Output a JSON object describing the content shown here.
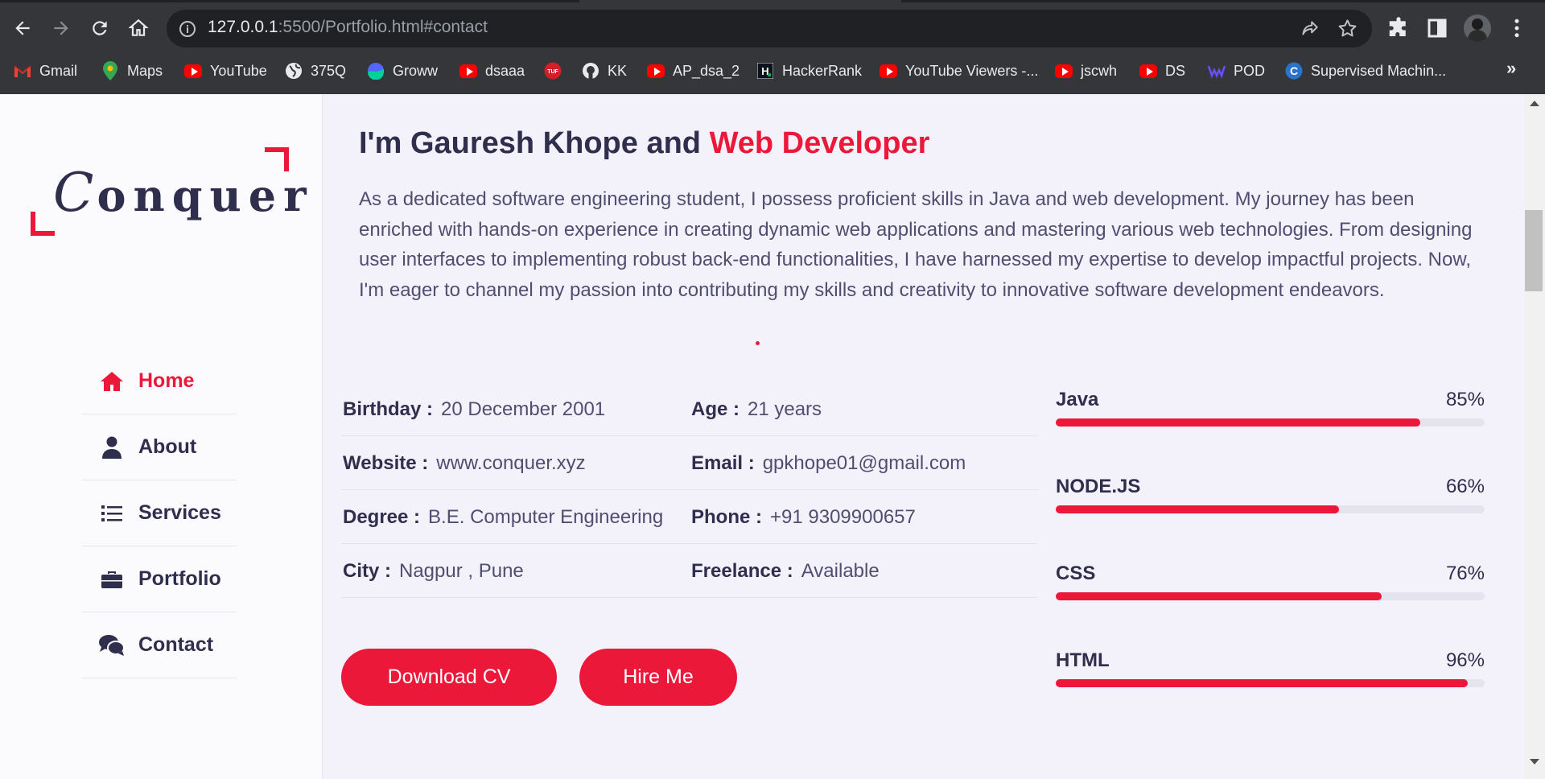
{
  "browser": {
    "url_host": "127.0.0.1",
    "url_rest": ":5500/Portfolio.html#contact",
    "bookmarks": [
      {
        "label": "Gmail",
        "icon": "gmail-icon"
      },
      {
        "label": "Maps",
        "icon": "maps-icon"
      },
      {
        "label": "YouTube",
        "icon": "youtube-icon"
      },
      {
        "label": "375Q",
        "icon": "globe-icon"
      },
      {
        "label": "Groww",
        "icon": "groww-icon"
      },
      {
        "label": "dsaaa",
        "icon": "youtube-icon"
      },
      {
        "label": "",
        "icon": "tuf-icon",
        "badge": "TUF"
      },
      {
        "label": "KK",
        "icon": "github-icon"
      },
      {
        "label": "AP_dsa_2",
        "icon": "youtube-icon"
      },
      {
        "label": "HackerRank",
        "icon": "hackerrank-icon",
        "badge": "H"
      },
      {
        "label": "YouTube Viewers -...",
        "icon": "youtube-icon"
      },
      {
        "label": "jscwh",
        "icon": "youtube-icon"
      },
      {
        "label": "DS",
        "icon": "youtube-icon"
      },
      {
        "label": "POD",
        "icon": "pod-icon"
      },
      {
        "label": "Supervised Machin...",
        "icon": "coursera-icon",
        "badge": "C"
      }
    ],
    "more": "»"
  },
  "sidebar": {
    "logo_initial": "C",
    "logo_rest": "onquer",
    "nav": [
      {
        "label": "Home",
        "icon": "home-icon",
        "active": true
      },
      {
        "label": "About",
        "icon": "user-icon",
        "active": false
      },
      {
        "label": "Services",
        "icon": "list-icon",
        "active": false
      },
      {
        "label": "Portfolio",
        "icon": "briefcase-icon",
        "active": false
      },
      {
        "label": "Contact",
        "icon": "comments-icon",
        "active": false
      }
    ]
  },
  "about": {
    "headline_prefix": "I'm Gauresh Khope and ",
    "headline_accent": "Web Developer",
    "intro": "As a dedicated software engineering student, I possess proficient skills in Java and web development. My journey has been enriched with hands-on experience in creating dynamic web applications and mastering various web technologies. From designing user interfaces to implementing robust back-end functionalities, I have harnessed my expertise to develop impactful projects. Now, I'm eager to channel my passion into contributing my skills and creativity to innovative software development endeavors.",
    "info": [
      {
        "left_label": "Birthday :",
        "left_value": "20 December 2001",
        "right_label": "Age :",
        "right_value": "21 years"
      },
      {
        "left_label": "Website :",
        "left_value": "www.conquer.xyz",
        "right_label": "Email :",
        "right_value": "gpkhope01@gmail.com"
      },
      {
        "left_label": "Degree :",
        "left_value": "B.E. Computer Engineering",
        "right_label": "Phone :",
        "right_value": "+91 9309900657"
      },
      {
        "left_label": "City :",
        "left_value": "Nagpur , Pune",
        "right_label": "Freelance :",
        "right_value": "Available"
      }
    ],
    "buttons": {
      "download_cv": "Download CV",
      "hire_me": "Hire Me"
    },
    "skills": [
      {
        "name": "Java",
        "percent_label": "85%",
        "percent": 85
      },
      {
        "name": "NODE.JS",
        "percent_label": "66%",
        "percent": 66
      },
      {
        "name": "CSS",
        "percent_label": "76%",
        "percent": 76
      },
      {
        "name": "HTML",
        "percent_label": "96%",
        "percent": 96
      }
    ]
  },
  "colors": {
    "accent": "#ec1839",
    "text_dark": "#302e4d",
    "text_body": "#504e70",
    "page_bg": "#f3f2fa"
  }
}
